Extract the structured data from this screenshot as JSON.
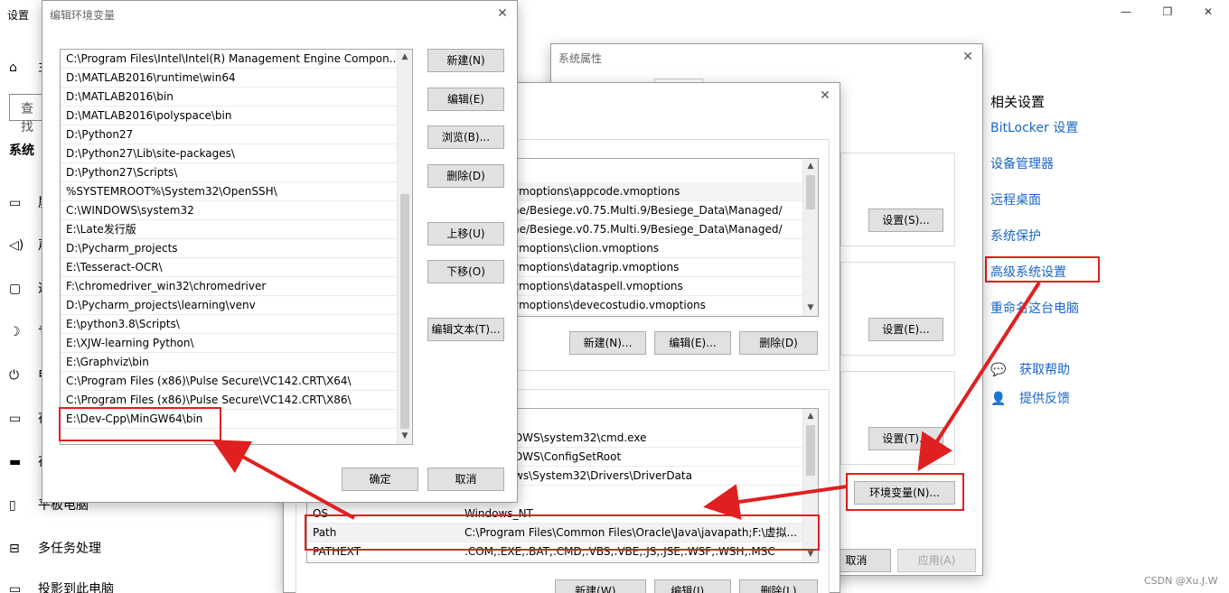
{
  "settings": {
    "title": "设置",
    "home_label": "主",
    "search_placeholder": "查找",
    "section": "系统",
    "side_items": [
      "屏",
      "声",
      "通",
      "专",
      "电",
      "存",
      "存",
      "平板电脑",
      "多任务处理",
      "投影到此电脑"
    ],
    "related_heading": "相关设置",
    "related_links": [
      "BitLocker 设置",
      "设备管理器",
      "远程桌面",
      "系统保护",
      "高级系统设置",
      "重命名这台电脑"
    ],
    "help_get": "获取帮助",
    "help_feedback": "提供反馈",
    "window_controls": [
      "—",
      "❐",
      "✕"
    ],
    "watermark": "CSDN @Xu.J.W"
  },
  "sys_props": {
    "title": "系统属性",
    "btn_settings_1": "设置(S)...",
    "btn_settings_2": "设置(E)...",
    "btn_settings_3": "设置(T)...",
    "btn_env": "环境变量(N)...",
    "btn_cancel": "取消",
    "btn_apply": "应用(A)"
  },
  "env_vars": {
    "user_rows": [
      "vmoptions\\appcode.vmoptions",
      "ne/Besiege.v0.75.Multi.9/Besiege_Data\\Managed/",
      "ne/Besiege.v0.75.Multi.9/Besiege_Data\\Managed/",
      "vmoptions\\clion.vmoptions",
      "vmoptions\\datagrip.vmoptions",
      "vmoptions\\dataspell.vmoptions",
      "vmoptions\\devecostudio.vmoptions"
    ],
    "btn_new": "新建(N)...",
    "btn_edit": "编辑(E)...",
    "btn_delete": "删除(D)",
    "sys_rows_top": [
      {
        "name": "",
        "value": "DWS\\system32\\cmd.exe"
      },
      {
        "name": "",
        "value": "DWS\\ConfigSetRoot"
      },
      {
        "name": "",
        "value": "ws\\System32\\Drivers\\DriverData"
      },
      {
        "name": "OS",
        "value": "Windows_NT"
      },
      {
        "name": "Path",
        "value": "C:\\Program Files\\Common Files\\Oracle\\Java\\javapath;F:\\虚拟..."
      },
      {
        "name": "PATHEXT",
        "value": ".COM;.EXE;.BAT;.CMD;.VBS;.VBE;.JS;.JSE;.WSF;.WSH;.MSC"
      }
    ],
    "btn_new_w": "新建(W)...",
    "btn_edit_i": "编辑(I)...",
    "btn_delete_l": "删除(L)"
  },
  "edit_env": {
    "title": "编辑环境变量",
    "paths": [
      "C:\\Program Files\\Intel\\Intel(R) Management Engine Compon...",
      "D:\\MATLAB2016\\runtime\\win64",
      "D:\\MATLAB2016\\bin",
      "D:\\MATLAB2016\\polyspace\\bin",
      "D:\\Python27",
      "D:\\Python27\\Lib\\site-packages\\",
      "D:\\Python27\\Scripts\\",
      "%SYSTEMROOT%\\System32\\OpenSSH\\",
      "C:\\WINDOWS\\system32",
      "E:\\Late发行版",
      "D:\\Pycharm_projects",
      "E:\\Tesseract-OCR\\",
      "F:\\chromedriver_win32\\chromedriver",
      "D:\\Pycharm_projects\\learning\\venv",
      "E:\\python3.8\\Scripts\\",
      "E:\\XJW-learning Python\\",
      "E:\\Graphviz\\bin",
      "C:\\Program Files (x86)\\Pulse Secure\\VC142.CRT\\X64\\",
      "C:\\Program Files (x86)\\Pulse Secure\\VC142.CRT\\X86\\",
      "E:\\Dev-Cpp\\MinGW64\\bin"
    ],
    "btn_new": "新建(N)",
    "btn_edit": "编辑(E)",
    "btn_browse": "浏览(B)...",
    "btn_delete": "删除(D)",
    "btn_up": "上移(U)",
    "btn_down": "下移(O)",
    "btn_edit_text": "编辑文本(T)...",
    "btn_ok": "确定",
    "btn_cancel": "取消"
  }
}
